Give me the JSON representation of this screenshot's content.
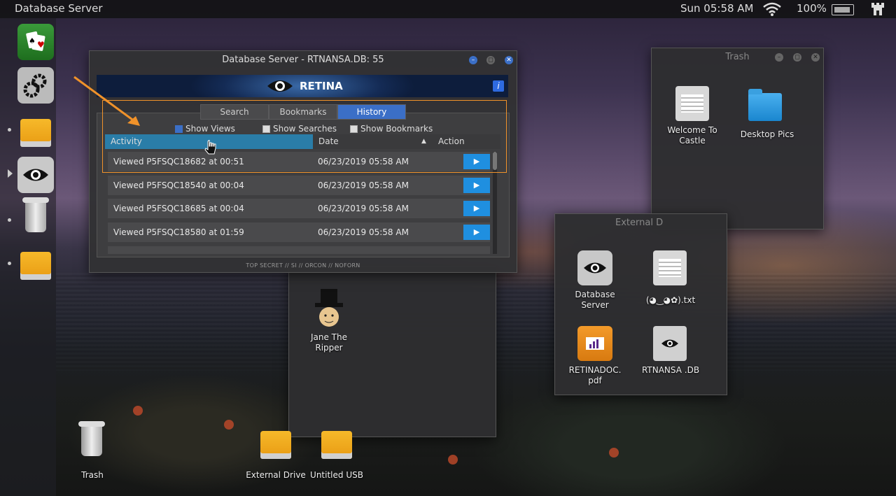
{
  "topbar": {
    "app_title": "Database Server",
    "clock": "Sun 05:58 AM",
    "battery": "100%"
  },
  "db_window": {
    "title": "Database Server - RTNANSA.DB: 55",
    "brand": "RETINA",
    "info": "i",
    "tabs": [
      "Search",
      "Bookmarks",
      "History"
    ],
    "active_tab": "History",
    "filters": [
      {
        "label": "Show Views",
        "checked": true
      },
      {
        "label": "Show Searches",
        "checked": false
      },
      {
        "label": "Show Bookmarks",
        "checked": false
      }
    ],
    "columns": {
      "activity": "Activity",
      "date": "Date",
      "action": "Action"
    },
    "sort_indicator": "▲",
    "play_symbol": "▶",
    "rows": [
      {
        "activity": "Viewed P5FSQC18682 at 00:51",
        "date": "06/23/2019 05:58 AM"
      },
      {
        "activity": "Viewed P5FSQC18540 at 00:04",
        "date": "06/23/2019 05:58 AM"
      },
      {
        "activity": "Viewed P5FSQC18685 at 00:04",
        "date": "06/23/2019 05:58 AM"
      },
      {
        "activity": "Viewed P5FSQC18580 at 01:59",
        "date": "06/23/2019 05:58 AM"
      }
    ],
    "footer": "TOP SECRET // SI // ORCON // NOFORN"
  },
  "trash_window": {
    "title": "Trash",
    "items": [
      "Welcome To Castle",
      "Desktop Pics"
    ]
  },
  "external_window": {
    "title": "External D",
    "items": [
      "Database Server",
      "(◕‿◕✿).txt",
      "RETINADOC. pdf",
      "RTNANSA .DB"
    ]
  },
  "jane_window": {
    "item": "Jane The Ripper"
  },
  "desktop": {
    "items": [
      "Trash",
      "External Drive",
      "Untitled USB"
    ]
  },
  "colors": {
    "accent": "#3b6fc7",
    "play": "#1f8fe0",
    "highlight": "#f0922a"
  }
}
